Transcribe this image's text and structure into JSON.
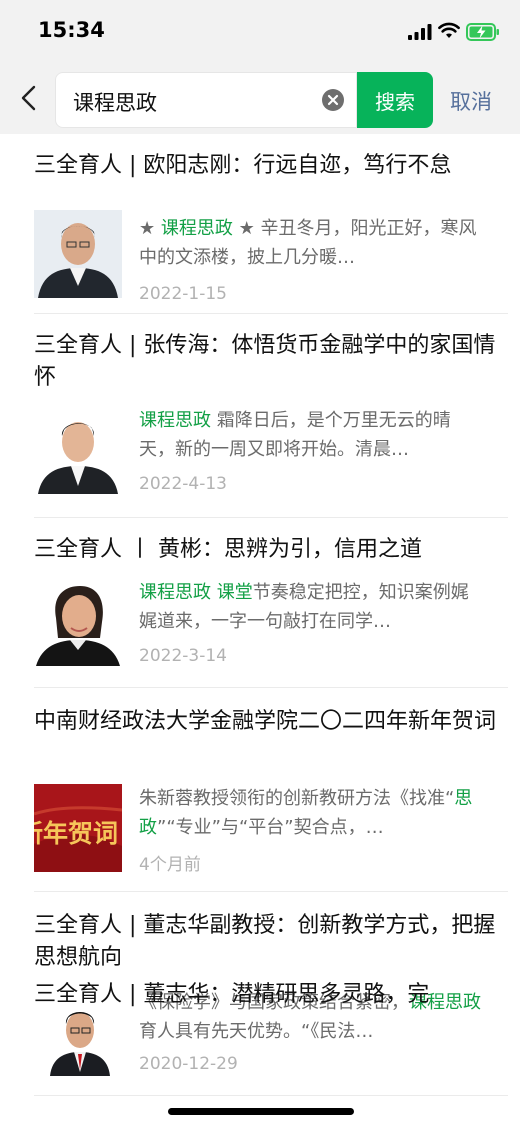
{
  "status": {
    "time": "15:34"
  },
  "search": {
    "query": "课程思政",
    "button_label": "搜索",
    "cancel_label": "取消"
  },
  "results": [
    {
      "title": "三全育人 | 欧阳志刚：行远自迩，笃行不怠",
      "snippet_parts": [
        {
          "text": "★ ",
          "hl": false
        },
        {
          "text": "课程思政",
          "hl": true
        },
        {
          "text": " ★ 辛丑冬月，阳光正好，寒风中的文添楼，披上几分暖…",
          "hl": false
        }
      ],
      "date": "2022-1-15",
      "thumb": "portrait"
    },
    {
      "title": "三全育人 | 张传海：体悟货币金融学中的家国情怀",
      "snippet_parts": [
        {
          "text": "课程思政",
          "hl": true
        },
        {
          "text": " 霜降日后，是个万里无云的晴天，新的一周又即将开始。清晨…",
          "hl": false
        }
      ],
      "date": "2022-4-13",
      "thumb": "portrait"
    },
    {
      "title": "三全育人 丨 黄彬：思辨为引，信用之道",
      "snippet_parts": [
        {
          "text": "课程思政 课堂",
          "hl": true
        },
        {
          "text": "节奏稳定把控，知识案例娓娓道来，一字一句敲打在同学…",
          "hl": false
        }
      ],
      "date": "2022-3-14",
      "thumb": "portrait"
    },
    {
      "title": "中南财经政法大学金融学院二〇二四年新年贺词",
      "snippet_parts": [
        {
          "text": "朱新蓉教授领衔的创新教研方法《找准“",
          "hl": false
        },
        {
          "text": "思政",
          "hl": true
        },
        {
          "text": "”“专业”与“平台”契合点，…",
          "hl": false
        }
      ],
      "date": "4个月前",
      "thumb": "newyear",
      "thumb_text": "新年贺词"
    },
    {
      "title": "三全育人 | 董志华副教授：创新教学方式，把握思想航向",
      "snippet_parts": [
        {
          "text": "《保险学》与国家政策结合紧密，",
          "hl": false
        },
        {
          "text": "课程思政",
          "hl": true
        },
        {
          "text": "育人具有先天优势。“《民法…",
          "hl": false
        }
      ],
      "date": "2020-12-29",
      "thumb": "portrait"
    }
  ],
  "peek_title": "三全育人 | 董志华：潜精研思多灵路，完",
  "colors": {
    "accent": "#07b35a",
    "highlight": "#13a046",
    "cancel": "#56709c"
  }
}
